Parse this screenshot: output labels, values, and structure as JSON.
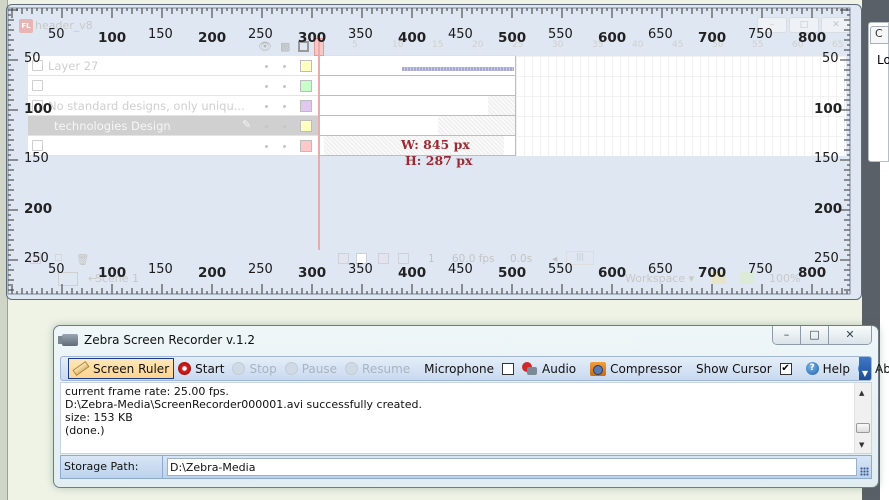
{
  "flash": {
    "doc_title": "header_v8",
    "file_badge": "FL",
    "layers": [
      {
        "name": "Layer 27",
        "swatch": "#ffffc0"
      },
      {
        "name": "",
        "swatch": "#c8ffc8"
      },
      {
        "name": "No standard designs, only uniqu...",
        "swatch": "#e0c8f0"
      },
      {
        "name": "technologies  Design",
        "swatch": "#ffffc0",
        "selected": true
      },
      {
        "name": "",
        "swatch": "#ffc8c8"
      }
    ],
    "timeline_frame_numbers": [
      "1",
      "5",
      "10",
      "15",
      "20",
      "25",
      "30",
      "35",
      "40",
      "45",
      "50",
      "55",
      "60",
      "65"
    ],
    "footer": {
      "current_frame": "1",
      "fps": "60.0 fps",
      "time": "0.0s"
    },
    "status": {
      "scene": "Scene 1",
      "workspace": "Workspace ▾",
      "zoom": "100%"
    }
  },
  "ruler": {
    "top_labels": [
      {
        "v": "50",
        "bold": false
      },
      {
        "v": "100",
        "bold": true
      },
      {
        "v": "150",
        "bold": false
      },
      {
        "v": "200",
        "bold": true
      },
      {
        "v": "250",
        "bold": false
      },
      {
        "v": "300",
        "bold": true
      },
      {
        "v": "350",
        "bold": false
      },
      {
        "v": "400",
        "bold": true
      },
      {
        "v": "450",
        "bold": false
      },
      {
        "v": "500",
        "bold": true
      },
      {
        "v": "550",
        "bold": false
      },
      {
        "v": "600",
        "bold": true
      },
      {
        "v": "650",
        "bold": false
      },
      {
        "v": "700",
        "bold": true
      },
      {
        "v": "750",
        "bold": false
      },
      {
        "v": "800",
        "bold": true
      }
    ],
    "side_labels": [
      {
        "v": "50",
        "bold": false
      },
      {
        "v": "100",
        "bold": true
      },
      {
        "v": "150",
        "bold": false
      },
      {
        "v": "200",
        "bold": true
      },
      {
        "v": "250",
        "bold": false
      }
    ],
    "width_readout": "W: 845 px",
    "height_readout": "H: 287 px"
  },
  "right_panel": {
    "tab_label": "C",
    "label": "Lo"
  },
  "zebra": {
    "title": "Zebra Screen Recorder v.1.2",
    "window_buttons": {
      "minimize": "–",
      "maximize": "□",
      "close": "✕"
    },
    "toolbar": {
      "screen_ruler": "Screen Ruler",
      "start": "Start",
      "stop": "Stop",
      "pause": "Pause",
      "resume": "Resume",
      "microphone": "Microphone",
      "microphone_checked": false,
      "audio": "Audio",
      "compressor": "Compressor",
      "show_cursor": "Show Cursor",
      "show_cursor_checked": true,
      "help": "Help",
      "about": "About"
    },
    "log": [
      "current frame rate: 25.00 fps.",
      "D:\\Zebra-Media\\ScreenRecorder000001.avi successfully created.",
      "size: 153 KB",
      "(done.)"
    ],
    "storage_label": "Storage Path:",
    "storage_path": "D:\\Zebra-Media"
  }
}
